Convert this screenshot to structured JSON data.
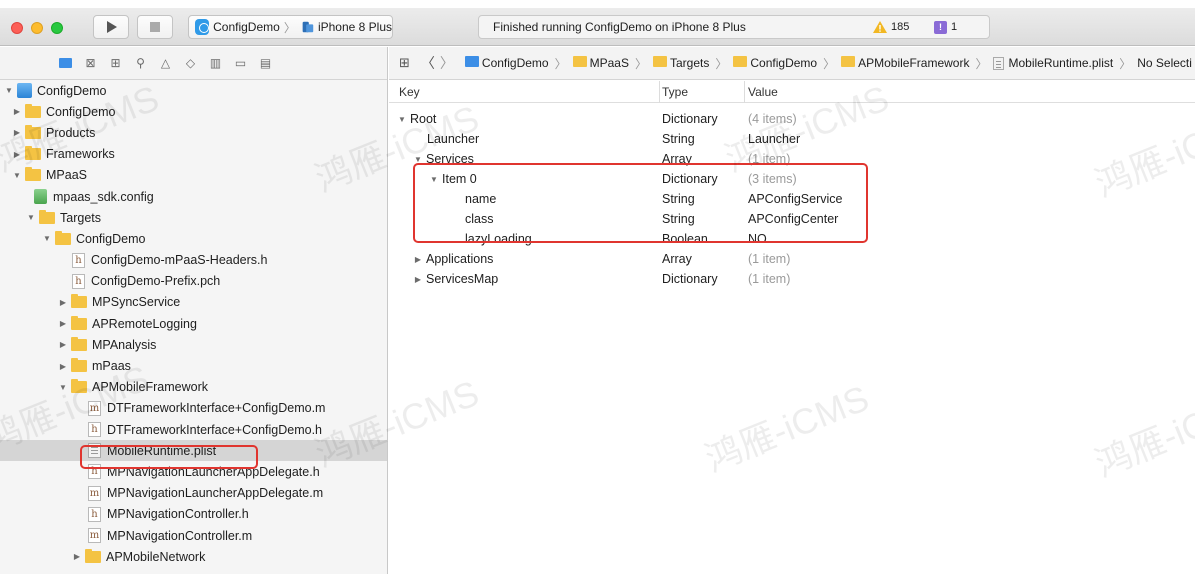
{
  "toolbar": {
    "scheme": "ConfigDemo",
    "device": "iPhone 8 Plus",
    "status": "Finished running ConfigDemo on iPhone 8 Plus",
    "warnings": "185",
    "issues": "1"
  },
  "navigator": {
    "items": [
      {
        "label": "ConfigDemo",
        "icon": "project-icon"
      },
      {
        "label": "ConfigDemo",
        "icon": "folder-icon"
      },
      {
        "label": "Products",
        "icon": "folder-icon"
      },
      {
        "label": "Frameworks",
        "icon": "folder-icon"
      },
      {
        "label": "MPaaS",
        "icon": "folder-icon"
      },
      {
        "label": "mpaas_sdk.config",
        "icon": "config-file-icon"
      },
      {
        "label": "Targets",
        "icon": "folder-icon"
      },
      {
        "label": "ConfigDemo",
        "icon": "folder-icon"
      },
      {
        "label": "ConfigDemo-mPaaS-Headers.h",
        "icon": "header-file-icon",
        "badge": "h"
      },
      {
        "label": "ConfigDemo-Prefix.pch",
        "icon": "header-file-icon",
        "badge": "h"
      },
      {
        "label": "MPSyncService",
        "icon": "folder-icon"
      },
      {
        "label": "APRemoteLogging",
        "icon": "folder-icon"
      },
      {
        "label": "MPAnalysis",
        "icon": "folder-icon"
      },
      {
        "label": "mPaas",
        "icon": "folder-icon"
      },
      {
        "label": "APMobileFramework",
        "icon": "folder-icon"
      },
      {
        "label": "DTFrameworkInterface+ConfigDemo.m",
        "icon": "source-file-icon",
        "badge": "m"
      },
      {
        "label": "DTFrameworkInterface+ConfigDemo.h",
        "icon": "header-file-icon",
        "badge": "h"
      },
      {
        "label": "MobileRuntime.plist",
        "icon": "plist-file-icon"
      },
      {
        "label": "MPNavigationLauncherAppDelegate.h",
        "icon": "header-file-icon",
        "badge": "h"
      },
      {
        "label": "MPNavigationLauncherAppDelegate.m",
        "icon": "source-file-icon",
        "badge": "m"
      },
      {
        "label": "MPNavigationController.h",
        "icon": "header-file-icon",
        "badge": "h"
      },
      {
        "label": "MPNavigationController.m",
        "icon": "source-file-icon",
        "badge": "m"
      },
      {
        "label": "APMobileNetwork",
        "icon": "folder-icon"
      }
    ]
  },
  "jumpbar": {
    "crumbs": [
      "ConfigDemo",
      "MPaaS",
      "Targets",
      "ConfigDemo",
      "APMobileFramework",
      "MobileRuntime.plist",
      "No Selecti"
    ]
  },
  "plist": {
    "headers": {
      "key": "Key",
      "type": "Type",
      "value": "Value"
    },
    "rows": [
      {
        "key": "Root",
        "type": "Dictionary",
        "value": "(4 items)"
      },
      {
        "key": "Launcher",
        "type": "String",
        "value": "Launcher"
      },
      {
        "key": "Services",
        "type": "Array",
        "value": "(1 item)"
      },
      {
        "key": "Item 0",
        "type": "Dictionary",
        "value": "(3 items)"
      },
      {
        "key": "name",
        "type": "String",
        "value": "APConfigService"
      },
      {
        "key": "class",
        "type": "String",
        "value": "APConfigCenter"
      },
      {
        "key": "lazyLoading",
        "type": "Boolean",
        "value": "NO"
      },
      {
        "key": "Applications",
        "type": "Array",
        "value": "(1 item)"
      },
      {
        "key": "ServicesMap",
        "type": "Dictionary",
        "value": "(1 item)"
      }
    ]
  },
  "watermark": "鸿雁-iCMS",
  "colors": {
    "highlight": "#e0352f",
    "folder": "#f4c343",
    "selection": "#d5d5d5"
  }
}
